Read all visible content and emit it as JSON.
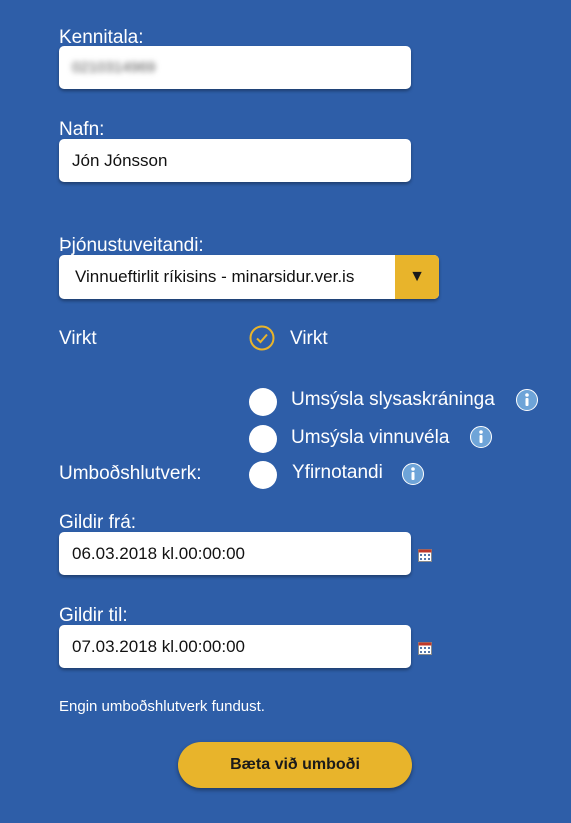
{
  "form": {
    "kennitala": {
      "label": "Kennitala:",
      "value": "0210314969"
    },
    "nafn": {
      "label": "Nafn:",
      "value": "Jón Jónsson"
    },
    "provider": {
      "label": "Þjónustuveitandi:",
      "value": "Vinnueftirlit ríkisins - minarsidur.ver.is"
    },
    "active": {
      "label": "Virkt",
      "option_label": "Virkt"
    },
    "roles": {
      "label": "Umboðshlutverk:",
      "options": [
        {
          "label": "Umsýsla slysaskráninga",
          "icon": "info-icon"
        },
        {
          "label": "Umsýsla vinnuvéla",
          "icon": "info-icon"
        },
        {
          "label": "Yfirnotandi",
          "icon": "info-icon"
        }
      ]
    },
    "valid_from": {
      "label": "Gildir frá:",
      "value": "06.03.2018 kl.00:00:00",
      "icon": "calendar-icon"
    },
    "valid_to": {
      "label": "Gildir til:",
      "value": "07.03.2018 kl.00:00:00",
      "icon": "calendar-icon"
    },
    "message": "Engin umboðshlutverk fundust.",
    "submit_label": "Bæta við umboði"
  },
  "colors": {
    "background": "#2e5ea8",
    "accent": "#e8b42b",
    "field": "#ffffff"
  }
}
